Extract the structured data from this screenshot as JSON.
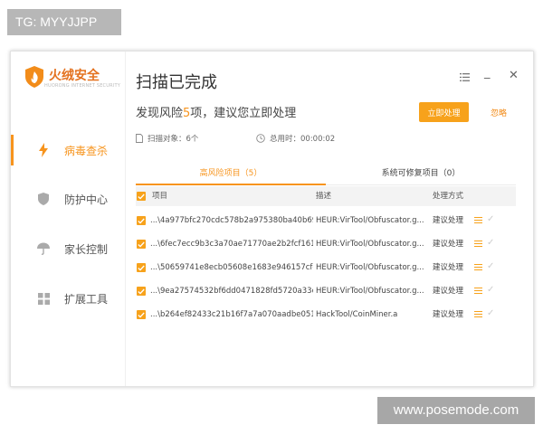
{
  "watermark_top": "TG: MYYJJPP",
  "watermark_bottom": "www.posemode.com",
  "app": {
    "logo_name": "火绒安全",
    "logo_sub": "HUORONG INTERNET SECURITY",
    "logo_icon": "flame-shield-icon",
    "accent_color": "#f7941d"
  },
  "sidebar": {
    "items": [
      {
        "label": "病毒查杀",
        "icon": "lightning-icon",
        "active": true
      },
      {
        "label": "防护中心",
        "icon": "shield-icon",
        "active": false
      },
      {
        "label": "家长控制",
        "icon": "umbrella-icon",
        "active": false
      },
      {
        "label": "扩展工具",
        "icon": "grid-icon",
        "active": false
      }
    ]
  },
  "window_controls": {
    "menu_icon": "menu-icon",
    "minimize": "_",
    "close": "✕"
  },
  "main": {
    "title": "扫描已完成",
    "subtitle_prefix": "发现风险",
    "risk_count": "5",
    "subtitle_suffix": "项，建议您立即处理",
    "action_button": "立即处理",
    "ignore_link": "忽略",
    "scan_objects": "扫描对象：6个",
    "total_time": "总用时：00:00:02"
  },
  "tabs": [
    {
      "label": "高风险项目（5）",
      "active": true
    },
    {
      "label": "系统可修复项目（0）",
      "active": false
    }
  ],
  "table": {
    "headers": [
      "项目",
      "描述",
      "处理方式"
    ],
    "rows": [
      {
        "item": "...\\4a977bfc270cdc578b2a975380ba40b69",
        "desc": "HEUR:VirTool/Obfuscator.g...",
        "action": "建议处理"
      },
      {
        "item": "...\\6fec7ecc9b3c3a70ae71770ae2b2fcf161",
        "desc": "HEUR:VirTool/Obfuscator.g...",
        "action": "建议处理"
      },
      {
        "item": "...\\50659741e8ecb05608e1683e946157cfc",
        "desc": "HEUR:VirTool/Obfuscator.g...",
        "action": "建议处理"
      },
      {
        "item": "...\\9ea27574532bf6dd0471828fd5720a33c",
        "desc": "HEUR:VirTool/Obfuscator.g...",
        "action": "建议处理"
      },
      {
        "item": "...\\b264ef82433c21b16f7a7a070aadbe051",
        "desc": "HackTool/CoinMiner.a",
        "action": "建议处理"
      }
    ]
  }
}
